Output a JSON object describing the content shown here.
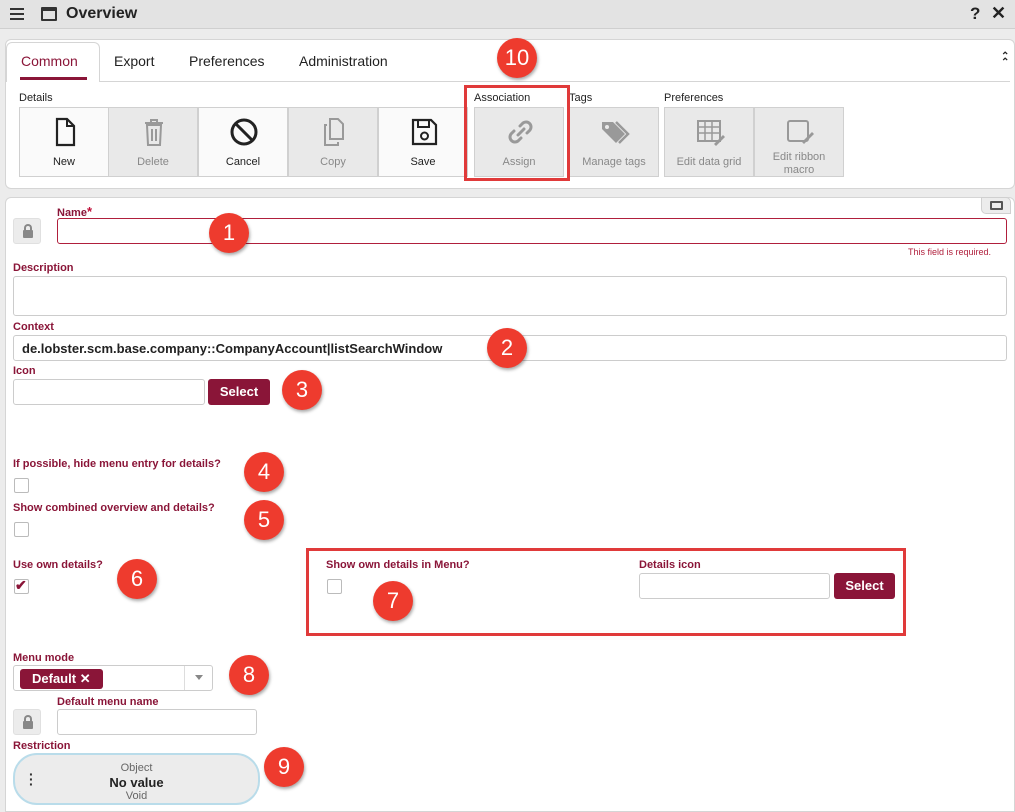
{
  "window": {
    "title": "Overview",
    "help": "?",
    "close": "✕"
  },
  "tabs": [
    "Common",
    "Export",
    "Preferences",
    "Administration"
  ],
  "ribbon": {
    "groups": {
      "details": "Details",
      "association": "Association",
      "tags": "Tags",
      "preferences": "Preferences"
    },
    "buttons": {
      "new": "New",
      "delete": "Delete",
      "cancel": "Cancel",
      "copy": "Copy",
      "save": "Save",
      "assign": "Assign",
      "manage_tags": "Manage tags",
      "edit_data_grid": "Edit data grid",
      "edit_ribbon_macro_1": "Edit ribbon",
      "edit_ribbon_macro_2": "macro"
    }
  },
  "form": {
    "name_label": "Name",
    "required_mark": "*",
    "name_value": "",
    "name_error": "This field is required.",
    "description_label": "Description",
    "description_value": "",
    "context_label": "Context",
    "context_value": "de.lobster.scm.base.company::CompanyAccount|listSearchWindow",
    "icon_label": "Icon",
    "icon_value": "",
    "select_label": "Select",
    "hide_menu_label": "If possible, hide menu entry for details?",
    "hide_menu_checked": false,
    "combined_label": "Show combined overview and details?",
    "combined_checked": false,
    "own_details_label": "Use own details?",
    "own_details_checked": true,
    "show_own_details_menu_label": "Show own details in Menu?",
    "show_own_details_menu_checked": false,
    "details_icon_label": "Details icon",
    "details_icon_value": "",
    "menu_mode_label": "Menu mode",
    "menu_mode_chip": "Default",
    "menu_mode_chip_remove": "✕",
    "default_menu_name_label": "Default menu name",
    "default_menu_name_value": "",
    "restriction_label": "Restriction",
    "restriction_object": "Object",
    "restriction_value": "No value",
    "restriction_type": "Void"
  },
  "annotations": [
    "1",
    "2",
    "3",
    "4",
    "5",
    "6",
    "7",
    "8",
    "9",
    "10"
  ],
  "colors": {
    "accent": "#8a1538",
    "annotation": "#ee3b2e",
    "error": "#b01f3c"
  }
}
